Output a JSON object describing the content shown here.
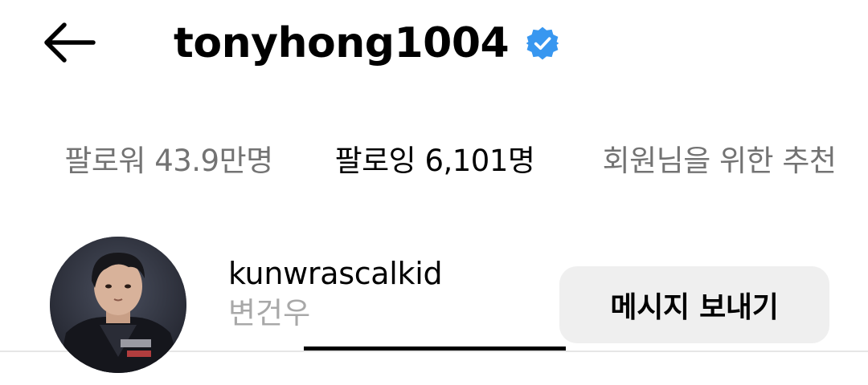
{
  "header": {
    "back_icon": "arrow-left-icon",
    "title": "tonyhong1004",
    "verified_icon": "verified-badge-icon",
    "verified_color": "#3897f0"
  },
  "tabs": [
    {
      "label": "팔로워 43.9만명",
      "active": false
    },
    {
      "label": "팔로잉 6,101명",
      "active": true
    },
    {
      "label": "회원님을 위한 추천",
      "active": false
    }
  ],
  "users": [
    {
      "username": "kunwrascalkid",
      "full_name": "변건우",
      "avatar_icon": "profile-photo",
      "action_label": "메시지 보내기"
    }
  ],
  "colors": {
    "primary_text": "#000000",
    "secondary_text": "#737373",
    "muted_text": "#a8a8a8",
    "button_bg": "#efefef",
    "divider": "#e6e6e6"
  }
}
